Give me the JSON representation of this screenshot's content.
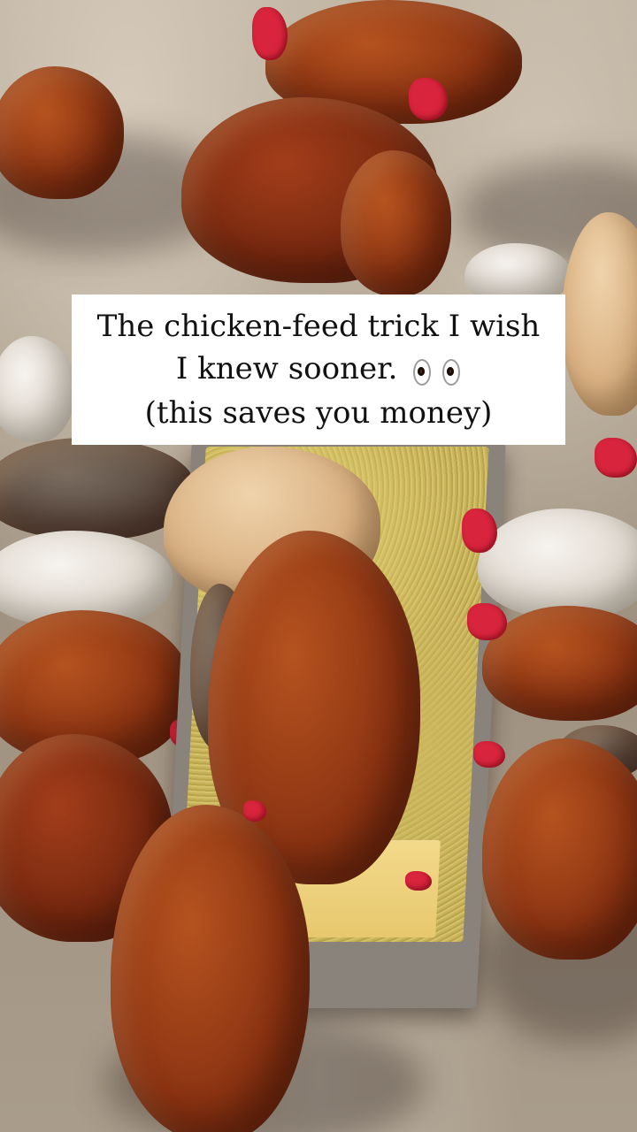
{
  "caption": {
    "line1": "The chicken-feed trick I wish",
    "line2": "I knew sooner.",
    "line2_emoji": "eyes-emoji",
    "line3": "(this saves you money)",
    "background_color": "#ffffff",
    "text_color": "#111111"
  },
  "photo": {
    "subject": "hens-eating-from-feed-trough",
    "colors": {
      "red_hen": "#8e3513",
      "white_hen": "#ddd6cc",
      "buff_hen": "#d9b183",
      "feed": "#c7b45a",
      "ground": "#a99c8a",
      "comb": "#d8243d"
    }
  }
}
